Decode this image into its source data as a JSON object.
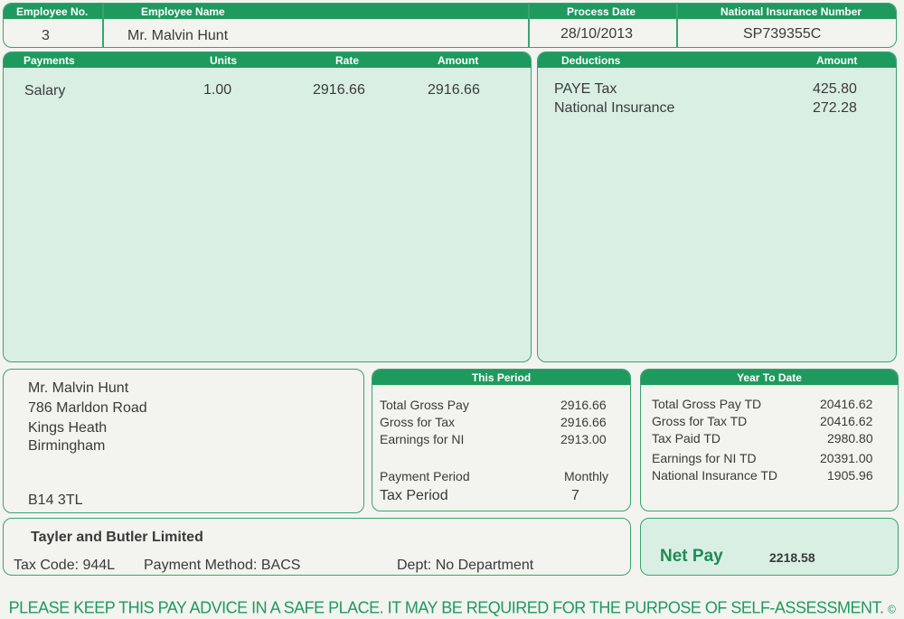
{
  "header": {
    "col_employee_no": "Employee No.",
    "col_employee_name": "Employee Name",
    "col_process_date": "Process Date",
    "col_ni_number": "National Insurance Number",
    "employee_no": "3",
    "employee_name": "Mr. Malvin Hunt",
    "process_date": "28/10/2013",
    "ni_number": "SP739355C"
  },
  "payments": {
    "col_payments": "Payments",
    "col_units": "Units",
    "col_rate": "Rate",
    "col_amount": "Amount",
    "rows": [
      {
        "name": "Salary",
        "units": "1.00",
        "rate": "2916.66",
        "amount": "2916.66"
      }
    ]
  },
  "deductions": {
    "col_deductions": "Deductions",
    "col_amount": "Amount",
    "rows": [
      {
        "name": "PAYE Tax",
        "amount": "425.80"
      },
      {
        "name": "National Insurance",
        "amount": "272.28"
      }
    ]
  },
  "address": {
    "line1": "Mr. Malvin Hunt",
    "line2": "786 Marldon Road",
    "line3": "Kings Heath",
    "line4": "Birmingham",
    "postcode": "B14 3TL"
  },
  "this_period": {
    "title": "This Period",
    "total_gross_pay_label": "Total Gross Pay",
    "total_gross_pay": "2916.66",
    "gross_for_tax_label": "Gross for Tax",
    "gross_for_tax": "2916.66",
    "earnings_ni_label": "Earnings for NI",
    "earnings_ni": "2913.00",
    "payment_period_label": "Payment Period",
    "payment_period": "Monthly",
    "tax_period_label": "Tax Period",
    "tax_period": "7"
  },
  "year_to_date": {
    "title": "Year To Date",
    "total_gross_pay_label": "Total Gross Pay TD",
    "total_gross_pay": "20416.62",
    "gross_for_tax_label": "Gross for Tax TD",
    "gross_for_tax": "20416.62",
    "tax_paid_label": "Tax Paid TD",
    "tax_paid": "2980.80",
    "earnings_ni_label": "Earnings for NI TD",
    "earnings_ni": "20391.00",
    "ni_label": "National Insurance TD",
    "ni": "1905.96"
  },
  "employer": {
    "name": "Tayler and Butler Limited",
    "tax_code": "Tax Code: 944L",
    "payment_method": "Payment Method: BACS",
    "dept": "Dept: No Department"
  },
  "net_pay": {
    "label": "Net Pay",
    "value": "2218.58"
  },
  "footer": {
    "text": "PLEASE KEEP THIS PAY ADVICE IN A SAFE PLACE. IT MAY BE REQUIRED FOR THE PURPOSE OF SELF-ASSESSMENT.",
    "copyright": "©"
  },
  "colors": {
    "accent": "#1f9a5f",
    "tint": "#d9efe4",
    "background": "#f3f3ef"
  }
}
